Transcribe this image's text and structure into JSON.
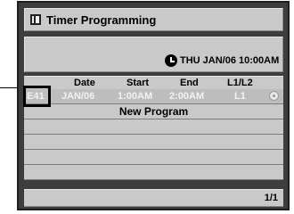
{
  "header": {
    "title": "Timer Programming"
  },
  "info": {
    "datetime": "THU JAN/06 10:00AM"
  },
  "columns": {
    "date": "Date",
    "start": "Start",
    "end": "End",
    "input": "L1/L2"
  },
  "program_row": {
    "id": "E41",
    "date": "JAN/06",
    "start": "1:00AM",
    "end": "2:00AM",
    "input": "L1"
  },
  "new_program_label": "New Program",
  "pagination": {
    "page": "1/1"
  },
  "icons": {
    "title": "document-icon",
    "clock": "clock-icon",
    "disc": "disc-icon"
  }
}
